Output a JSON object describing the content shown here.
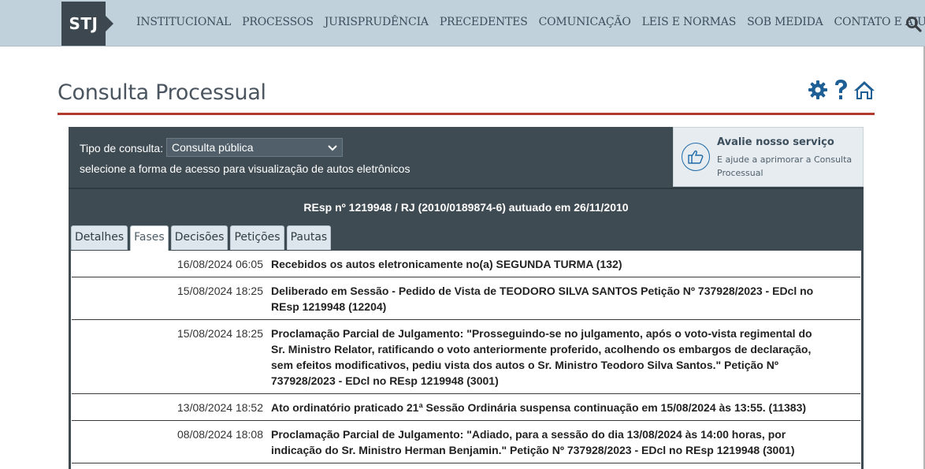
{
  "logo": "STJ",
  "nav": [
    "INSTITUCIONAL",
    "PROCESSOS",
    "JURISPRUDÊNCIA",
    "PRECEDENTES",
    "COMUNICAÇÃO",
    "LEIS E NORMAS",
    "SOB MEDIDA",
    "CONTATO E AJUDA"
  ],
  "page": {
    "title": "Consulta Processual"
  },
  "consulta": {
    "label": "Tipo de consulta:",
    "selected": "Consulta pública",
    "hint": "selecione a forma de acesso para visualização de autos eletrônicos"
  },
  "avalie": {
    "title": "Avalie nosso serviço",
    "subtitle": "E ajude a aprimorar a Consulta Processual"
  },
  "processo": {
    "title": "REsp nº 1219948 / RJ (2010/0189874-6) autuado em 26/11/2010"
  },
  "tabs": [
    "Detalhes",
    "Fases",
    "Decisões",
    "Petições",
    "Pautas"
  ],
  "active_tab": "Fases",
  "fases": [
    {
      "date": "16/08/2024 06:05",
      "text": "Recebidos os autos eletronicamente no(a) SEGUNDA TURMA (132)"
    },
    {
      "date": "15/08/2024 18:25",
      "text": "Deliberado em Sessão - Pedido de Vista de TEODORO SILVA SANTOS Petição Nº 737928/2023 - EDcl no REsp 1219948 (12204)"
    },
    {
      "date": "15/08/2024 18:25",
      "text": "Proclamação Parcial de Julgamento: \"Prosseguindo-se no julgamento, após o voto-vista regimental do Sr. Ministro Relator, ratificando o voto anteriormente proferido, acolhendo os embargos de declaração, sem efeitos modificativos, pediu vista dos autos o Sr. Ministro Teodoro Silva Santos.\" Petição Nº 737928/2023 - EDcl no REsp 1219948 (3001)"
    },
    {
      "date": "13/08/2024 18:52",
      "text": "Ato ordinatório praticado 21ª Sessão Ordinária suspensa continuação em 15/08/2024 às 13:55. (11383)"
    },
    {
      "date": "08/08/2024 18:08",
      "text": "Proclamação Parcial de Julgamento: \"Adiado, para a sessão do dia 13/08/2024 às 14:00 horas, por indicação do Sr. Ministro Herman Benjamin.\" Petição Nº 737928/2023 - EDcl no REsp 1219948 (3001)"
    }
  ],
  "colors": {
    "topbar": "#c1d1dc",
    "panel": "#3f4b53",
    "accent_rule": "#b13a2c",
    "icon_blue": "#1e5f96"
  }
}
